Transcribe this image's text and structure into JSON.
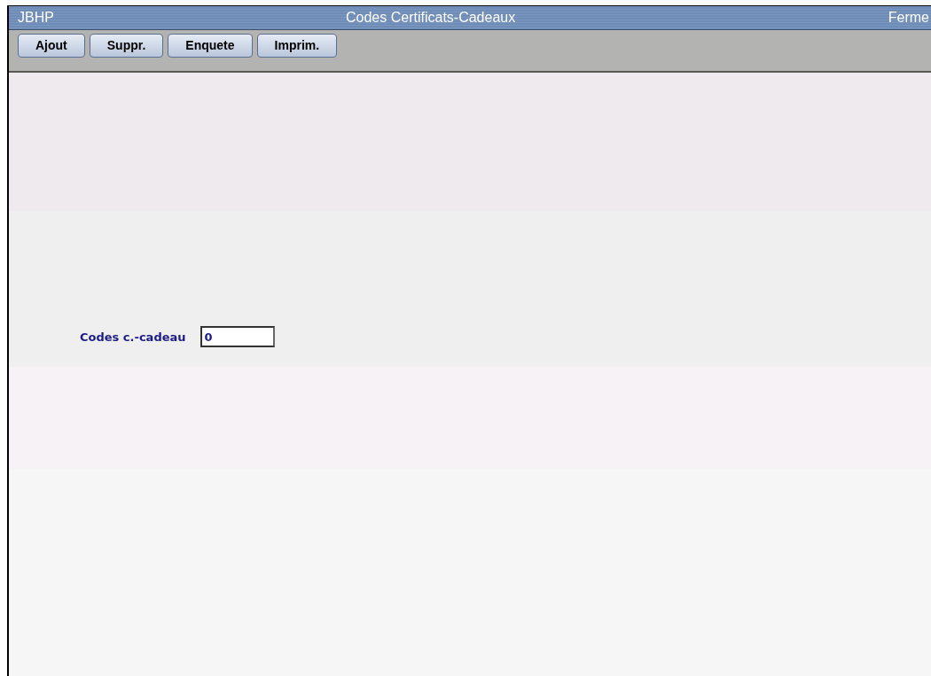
{
  "window": {
    "app": "JBHP",
    "title": "Codes Certificats-Cadeaux",
    "close": "Ferme"
  },
  "toolbar": {
    "buttons": [
      "Ajout",
      "Suppr.",
      "Enquete",
      "Imprim."
    ]
  },
  "form": {
    "fields": [
      {
        "label": "Codes c.-cadeau",
        "value": "0"
      }
    ]
  }
}
